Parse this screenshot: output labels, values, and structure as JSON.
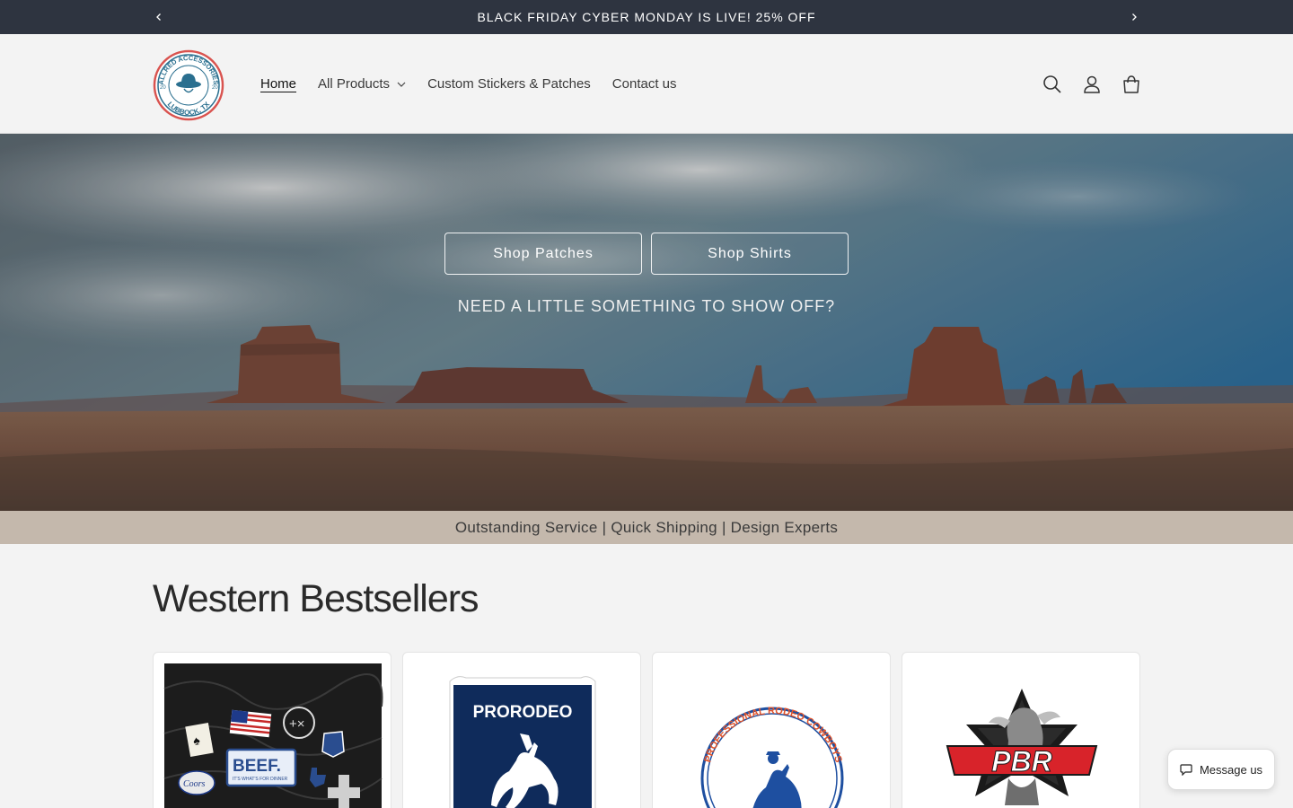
{
  "announcement": {
    "text": "BLACK FRIDAY CYBER MONDAY IS LIVE! 25% OFF",
    "prev_icon": "chevron-left-icon",
    "next_icon": "chevron-right-icon"
  },
  "header": {
    "logo_text_top": "ALLRED ACCESSORIES",
    "logo_text_bottom": "LUBBOCK, TX",
    "logo_year_left": "20",
    "logo_year_right": "20",
    "nav": [
      {
        "label": "Home",
        "active": true
      },
      {
        "label": "All Products",
        "has_dropdown": true
      },
      {
        "label": "Custom Stickers & Patches"
      },
      {
        "label": "Contact us"
      }
    ],
    "icons": [
      "search-icon",
      "account-icon",
      "cart-icon"
    ]
  },
  "hero": {
    "buttons": [
      "Shop Patches",
      "Shop Shirts"
    ],
    "subtitle": "NEED A LITTLE SOMETHING TO SHOW OFF?"
  },
  "tagline": "Outstanding Service | Quick Shipping | Design Experts",
  "bestsellers": {
    "title": "Western Bestsellers",
    "products": [
      {
        "image": "patch-collection",
        "labels": [
          "BEEF.",
          "IT'S WHAT'S FOR DINNER",
          "Coors"
        ]
      },
      {
        "image": "prorodeo-badge",
        "labels": [
          "PRORODEO"
        ]
      },
      {
        "image": "professional-rodeo-cowboys-logo",
        "labels": [
          "PROFESSIONAL RODEO COWBOYS"
        ]
      },
      {
        "image": "pbr-logo",
        "labels": [
          "PBR"
        ]
      }
    ]
  },
  "chat": {
    "label": "Message us",
    "icon": "chat-bubble-icon"
  },
  "colors": {
    "announcement_bg": "#2e3440",
    "tagline_bg": "#c4b8ac",
    "page_bg": "#f3f3f3"
  }
}
